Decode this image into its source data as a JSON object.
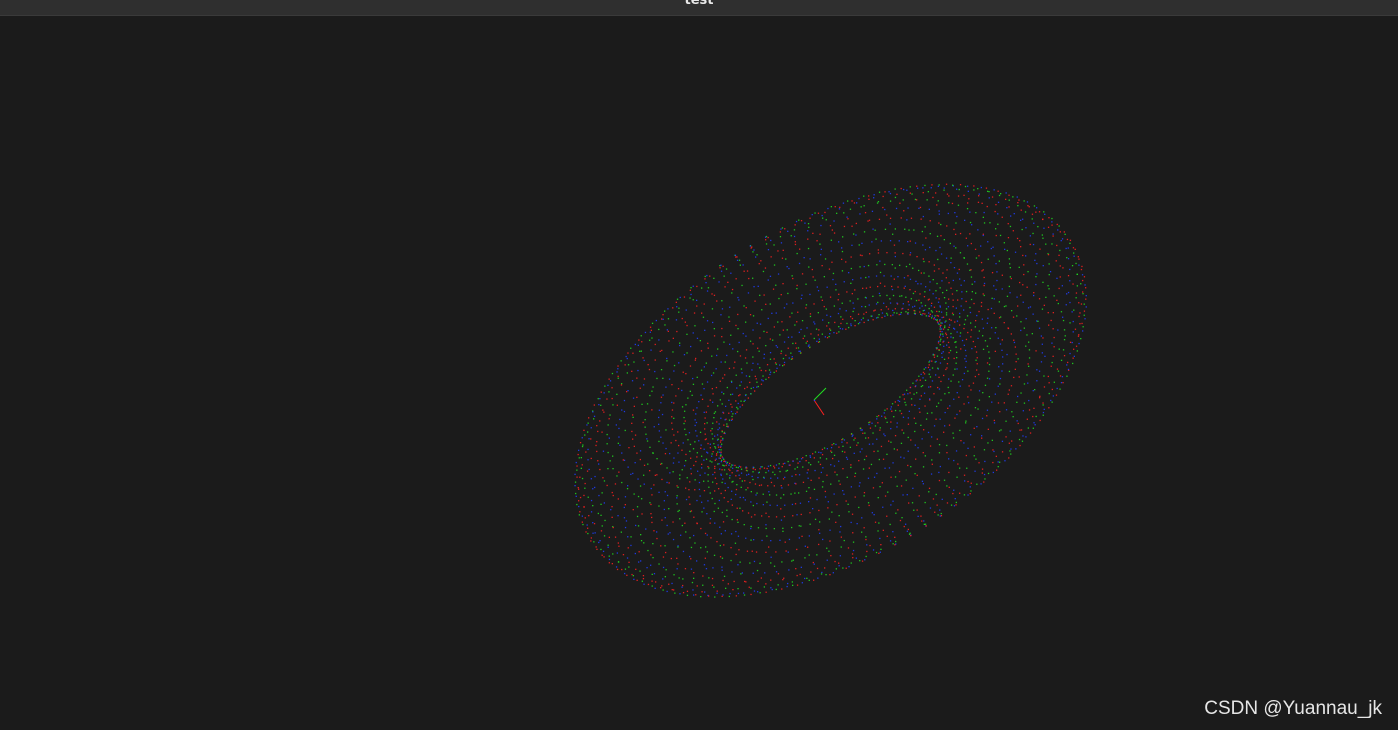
{
  "window": {
    "title": "test"
  },
  "viewport": {
    "background_color": "#1b1b1b",
    "point_colors": [
      "#ff2020",
      "#20e020",
      "#2040ff"
    ],
    "axis_colors": {
      "x_axis": "#ff2020",
      "y_axis": "#20e020",
      "z_axis": "#2040ff"
    },
    "content": "point-cloud-torus"
  },
  "watermark": {
    "text": "CSDN @Yuannau_jk"
  }
}
